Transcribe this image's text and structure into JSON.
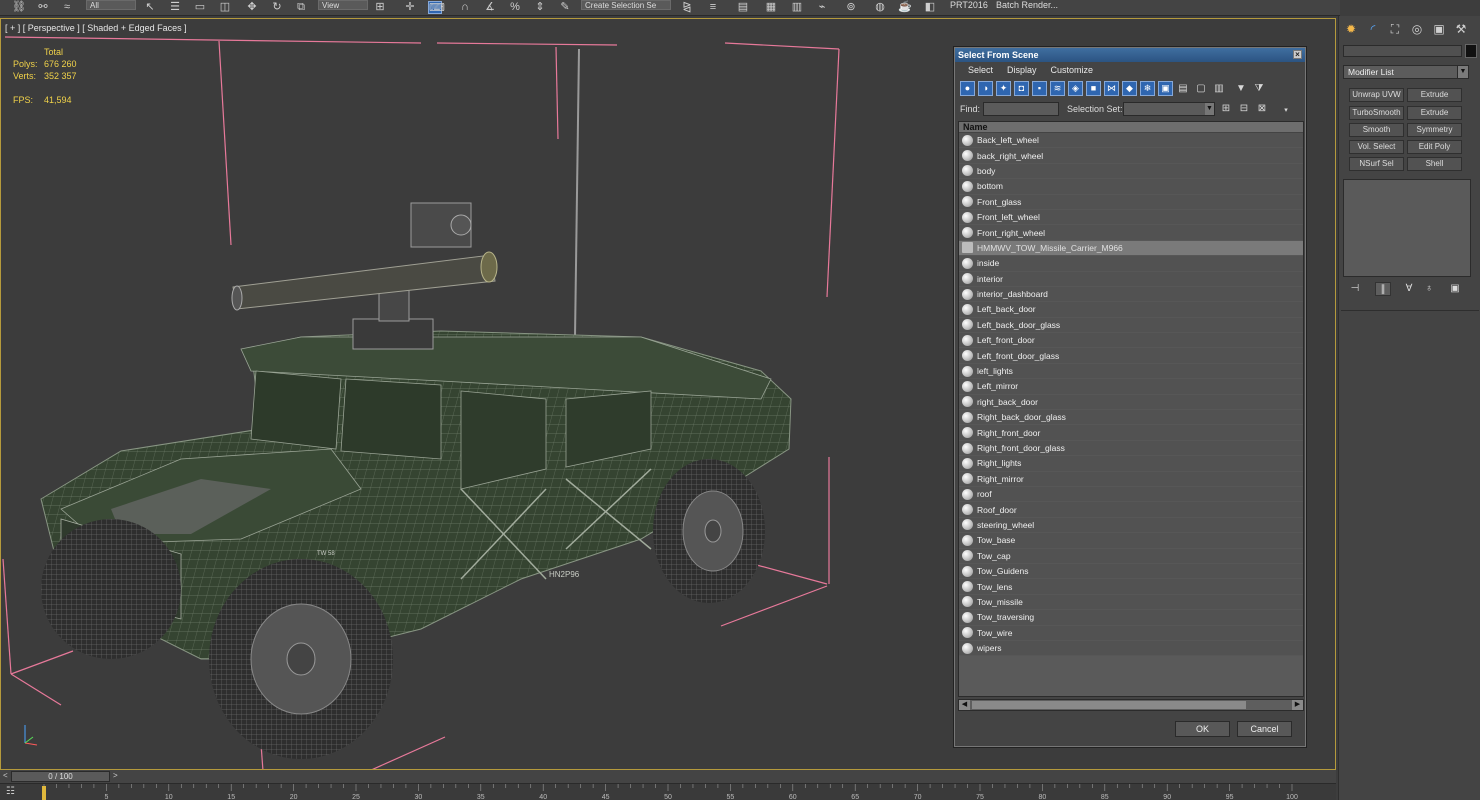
{
  "toolbar": {
    "view_drop": "View",
    "all_drop": "All",
    "selection_set": "Create Selection Se",
    "prt_label": "PRT2016",
    "batch_render": "Batch Render..."
  },
  "viewport": {
    "label": "[ + ] [ Perspective ] [ Shaded + Edged Faces ]",
    "stats_header": "Total",
    "polys_label": "Polys:",
    "polys_value": "676 260",
    "verts_label": "Verts:",
    "verts_value": "352 357",
    "fps_label": "FPS:",
    "fps_value": "41,594",
    "decals": [
      "HN2P96",
      "TW 58"
    ]
  },
  "dialog": {
    "title": "Select From Scene",
    "menu": [
      "Select",
      "Display",
      "Customize"
    ],
    "find_label": "Find:",
    "find_value": "",
    "selection_set_label": "Selection Set:",
    "column_header": "Name",
    "selected_item": "HMMWV_TOW_Missile_Carrier_M966",
    "items": [
      "Back_left_wheel",
      "back_right_wheel",
      "body",
      "bottom",
      "Front_glass",
      "Front_left_wheel",
      "Front_right_wheel",
      "HMMWV_TOW_Missile_Carrier_M966",
      "inside",
      "interior",
      "interior_dashboard",
      "Left_back_door",
      "Left_back_door_glass",
      "Left_front_door",
      "Left_front_door_glass",
      "left_lights",
      "Left_mirror",
      "right_back_door",
      "Right_back_door_glass",
      "Right_front_door",
      "Right_front_door_glass",
      "Right_lights",
      "Right_mirror",
      "roof",
      "Roof_door",
      "steering_wheel",
      "Tow_base",
      "Tow_cap",
      "Tow_Guidens",
      "Tow_lens",
      "Tow_missile",
      "Tow_traversing",
      "Tow_wire",
      "wipers"
    ],
    "ok_label": "OK",
    "cancel_label": "Cancel"
  },
  "command_panel": {
    "modifier_list": "Modifier List",
    "modifiers": [
      "Unwrap UVW",
      "Extrude",
      "TurboSmooth",
      "Extrude",
      "Smooth",
      "Symmetry",
      "Vol. Select",
      "Edit Poly",
      "NSurf Sel",
      "Shell"
    ]
  },
  "timeline": {
    "frame": "0 / 100",
    "prev": "<",
    "next": ">",
    "ticks": [
      "0",
      "5",
      "10",
      "15",
      "20",
      "25",
      "30",
      "35",
      "40",
      "45",
      "50",
      "55",
      "60",
      "65",
      "70",
      "75",
      "80",
      "85",
      "90",
      "95",
      "100"
    ]
  },
  "colors": {
    "viewport_border": "#b59a3c",
    "stats_text": "#f0d24a",
    "bbox_lines": "#e7799a",
    "vehicle_fill": "#3a4a36",
    "title_bar": "#2c5482"
  }
}
